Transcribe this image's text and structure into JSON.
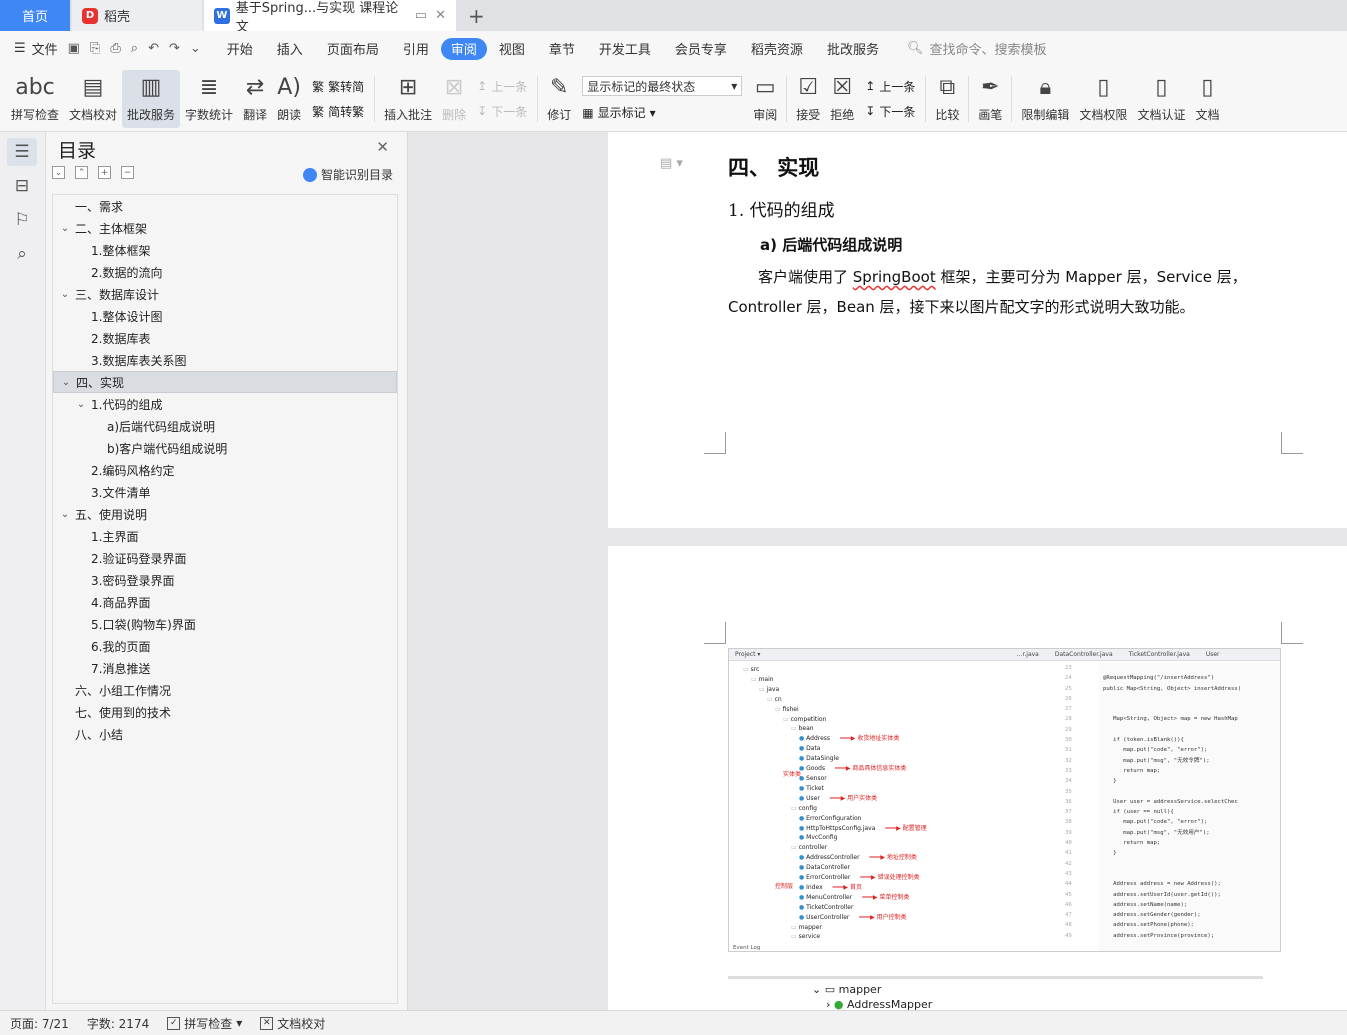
{
  "tabs": {
    "home": "首页",
    "daoke": "稻壳",
    "doc": "基于Spring...与实现 课程论文"
  },
  "menu": {
    "file": "文件",
    "items": [
      "开始",
      "插入",
      "页面布局",
      "引用",
      "审阅",
      "视图",
      "章节",
      "开发工具",
      "会员专享",
      "稻壳资源",
      "批改服务"
    ],
    "active": "审阅",
    "search": "查找命令、搜索模板"
  },
  "ribbon": {
    "spell": "拼写检查",
    "proof": "文档校对",
    "correct": "批改服务",
    "wordcount": "字数统计",
    "translate": "翻译",
    "read": "朗读",
    "to_simple": "繁转简",
    "to_trad": "简转繁",
    "insert_comment": "插入批注",
    "delete": "删除",
    "prev": "上一条",
    "next": "下一条",
    "revise": "修订",
    "show_state": "显示标记的最终状态",
    "show_marks": "显示标记",
    "review": "审阅",
    "accept": "接受",
    "reject": "拒绝",
    "prev2": "上一条",
    "next2": "下一条",
    "compare": "比较",
    "pen": "画笔",
    "restrict": "限制编辑",
    "permission": "文档权限",
    "certify": "文档认证",
    "more": "文档"
  },
  "toc": {
    "title": "目录",
    "smart": "智能识别目录",
    "items": [
      {
        "label": "一、需求",
        "level": 1,
        "chev": ""
      },
      {
        "label": "二、主体框架",
        "level": 1,
        "chev": "v"
      },
      {
        "label": "1.整体框架",
        "level": 2,
        "chev": ""
      },
      {
        "label": "2.数据的流向",
        "level": 2,
        "chev": ""
      },
      {
        "label": "三、数据库设计",
        "level": 1,
        "chev": "v"
      },
      {
        "label": "1.整体设计图",
        "level": 2,
        "chev": ""
      },
      {
        "label": "2.数据库表",
        "level": 2,
        "chev": ""
      },
      {
        "label": "3.数据库表关系图",
        "level": 2,
        "chev": ""
      },
      {
        "label": "四、实现",
        "level": 1,
        "chev": "v",
        "selected": true
      },
      {
        "label": "1.代码的组成",
        "level": 2,
        "chev": "v"
      },
      {
        "label": "a)后端代码组成说明",
        "level": 3,
        "chev": ""
      },
      {
        "label": "b)客户端代码组成说明",
        "level": 3,
        "chev": ""
      },
      {
        "label": "2.编码风格约定",
        "level": 2,
        "chev": ""
      },
      {
        "label": "3.文件清单",
        "level": 2,
        "chev": ""
      },
      {
        "label": "五、使用说明",
        "level": 1,
        "chev": "v"
      },
      {
        "label": "1.主界面",
        "level": 2,
        "chev": ""
      },
      {
        "label": "2.验证码登录界面",
        "level": 2,
        "chev": ""
      },
      {
        "label": "3.密码登录界面",
        "level": 2,
        "chev": ""
      },
      {
        "label": "4.商品界面",
        "level": 2,
        "chev": ""
      },
      {
        "label": "5.口袋(购物车)界面",
        "level": 2,
        "chev": ""
      },
      {
        "label": "6.我的页面",
        "level": 2,
        "chev": ""
      },
      {
        "label": "7.消息推送",
        "level": 2,
        "chev": ""
      },
      {
        "label": "六、小组工作情况",
        "level": 1,
        "chev": ""
      },
      {
        "label": "七、使用到的技术",
        "level": 1,
        "chev": ""
      },
      {
        "label": "八、小结",
        "level": 1,
        "chev": ""
      }
    ]
  },
  "doc": {
    "h1": "四、 实现",
    "h2": "1.  代码的组成",
    "h3": "a)   后端代码组成说明",
    "para_pre": "客户端使用了 ",
    "para_sb": "SpringBoot",
    "para_post": " 框架，主要可分为 Mapper 层，Service 层，Controller 层，Bean 层，接下来以图片配文字的形式说明大致功能。"
  },
  "screenshot": {
    "header": [
      "Project ▾",
      "…r.java",
      "DataController.java",
      "TicketController.java",
      "User"
    ],
    "tree": [
      {
        "t": "src",
        "d": 1
      },
      {
        "t": "main",
        "d": 2
      },
      {
        "t": "java",
        "d": 3
      },
      {
        "t": "cn",
        "d": 4
      },
      {
        "t": "fishei",
        "d": 5
      },
      {
        "t": "competition",
        "d": 6
      },
      {
        "t": "bean",
        "d": 7
      },
      {
        "t": "Address",
        "d": 8,
        "note": "收货地址实体类"
      },
      {
        "t": "Data",
        "d": 8
      },
      {
        "t": "DataSingle",
        "d": 8
      },
      {
        "t": "Goods",
        "d": 8,
        "note": "商品具体信息实体类"
      },
      {
        "t": "Sensor",
        "d": 8
      },
      {
        "t": "Ticket",
        "d": 8
      },
      {
        "t": "User",
        "d": 8,
        "note": "用户实体类"
      },
      {
        "t": "config",
        "d": 7
      },
      {
        "t": "ErrorConfiguration",
        "d": 8
      },
      {
        "t": "HttpToHttpsConfig.java",
        "d": 8,
        "note": "配置管理"
      },
      {
        "t": "MvcConfig",
        "d": 8
      },
      {
        "t": "controller",
        "d": 7
      },
      {
        "t": "AddressController",
        "d": 8,
        "note": "地址控制类"
      },
      {
        "t": "DataController",
        "d": 8
      },
      {
        "t": "ErrorController",
        "d": 8,
        "note": "错误处理控制类"
      },
      {
        "t": "Index",
        "d": 8,
        "note": "首页"
      },
      {
        "t": "MenuController",
        "d": 8,
        "note": "菜单控制类"
      },
      {
        "t": "TicketController",
        "d": 8
      },
      {
        "t": "UserController",
        "d": 8,
        "note": "用户控制类"
      },
      {
        "t": "mapper",
        "d": 7
      },
      {
        "t": "service",
        "d": 7
      }
    ],
    "side_label_bean": "实体类",
    "side_label_ctrl": "控制层",
    "footer": "Event Log",
    "line_numbers": "23\n24\n25\n26\n27\n28\n29\n30\n31\n32\n33\n34\n35\n36\n37\n38\n39\n40\n41\n42\n43\n44\n45\n46\n47\n48\n49",
    "code": "\n@RequestMapping(\"/insertAddress\")\npublic Map<String, Object> insertAddress(\n\n\n   Map<String, Object> map = new HashMap\n\n   if (token.isBlank()){\n      map.put(\"code\", \"error\");\n      map.put(\"msg\", \"无效令牌\");\n      return map;\n   }\n\n   User user = addressService.selectChec\n   if (user == null){\n      map.put(\"code\", \"error\");\n      map.put(\"msg\", \"无效用户\");\n      return map;\n   }\n\n\n   Address address = new Address();\n   address.setUserId(user.getId());\n   address.setName(name);\n   address.setGender(gender);\n   address.setPhone(phone);\n   address.setProvince(province);"
  },
  "below_tree": {
    "a": "mapper",
    "b": "AddressMapper"
  },
  "status": {
    "page": "页面: 7/21",
    "words": "字数: 2174",
    "spell": "拼写检查",
    "proof": "文档校对"
  }
}
